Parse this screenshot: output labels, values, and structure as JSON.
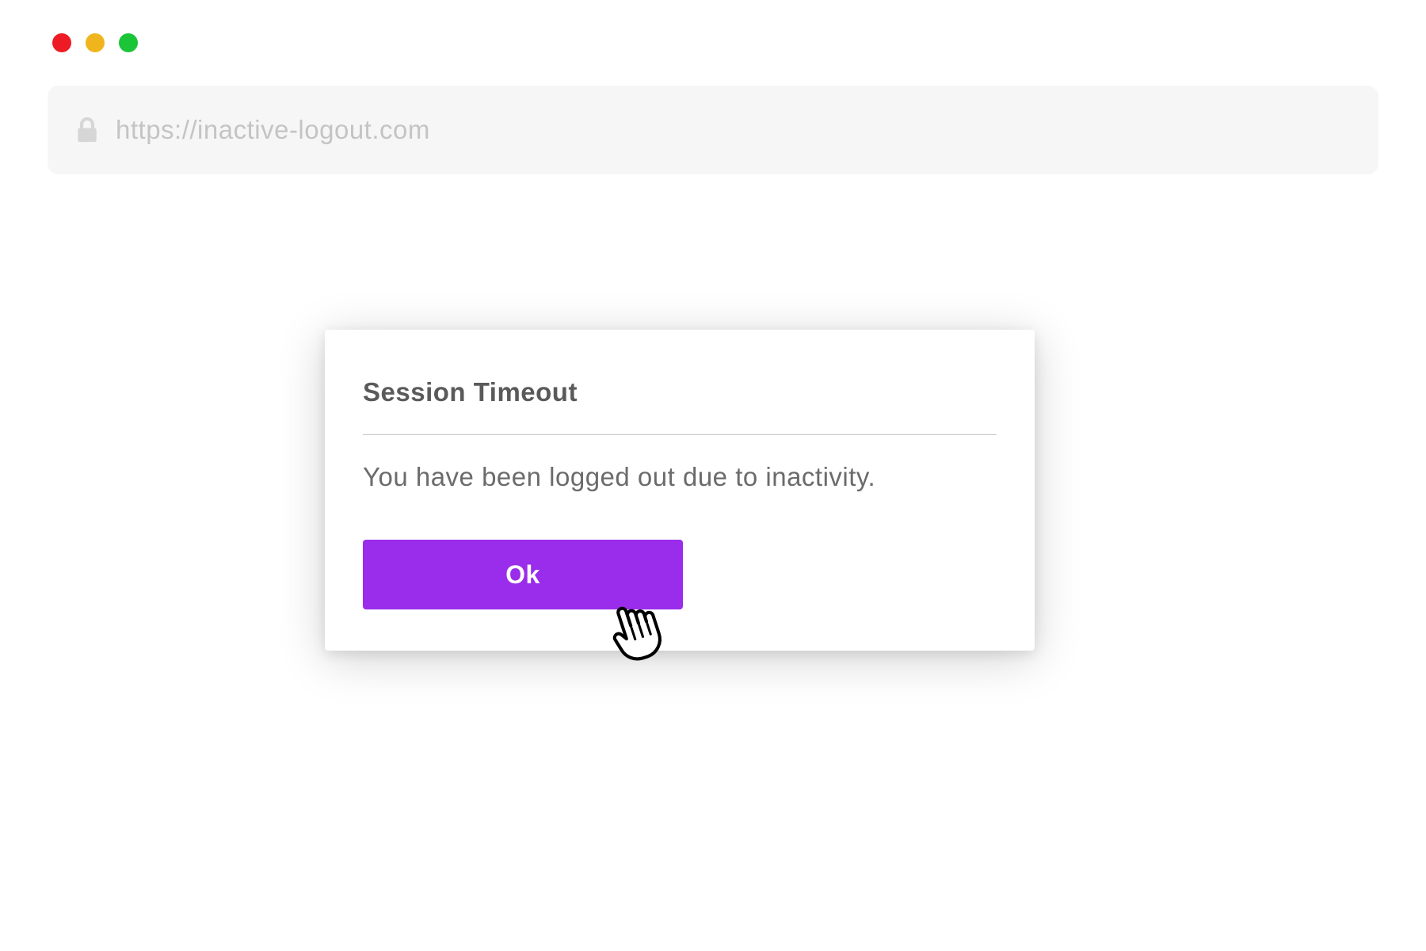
{
  "window": {
    "traffic_lights": [
      "close",
      "minimize",
      "zoom"
    ]
  },
  "address_bar": {
    "url": "https://inactive-logout.com"
  },
  "dialog": {
    "title": "Session Timeout",
    "message": "You have been logged out due to inactivity.",
    "ok_label": "Ok"
  },
  "colors": {
    "accent": "#9a2ceb",
    "red": "#ed1c24",
    "yellow": "#f0b51d",
    "green": "#1cc438"
  }
}
